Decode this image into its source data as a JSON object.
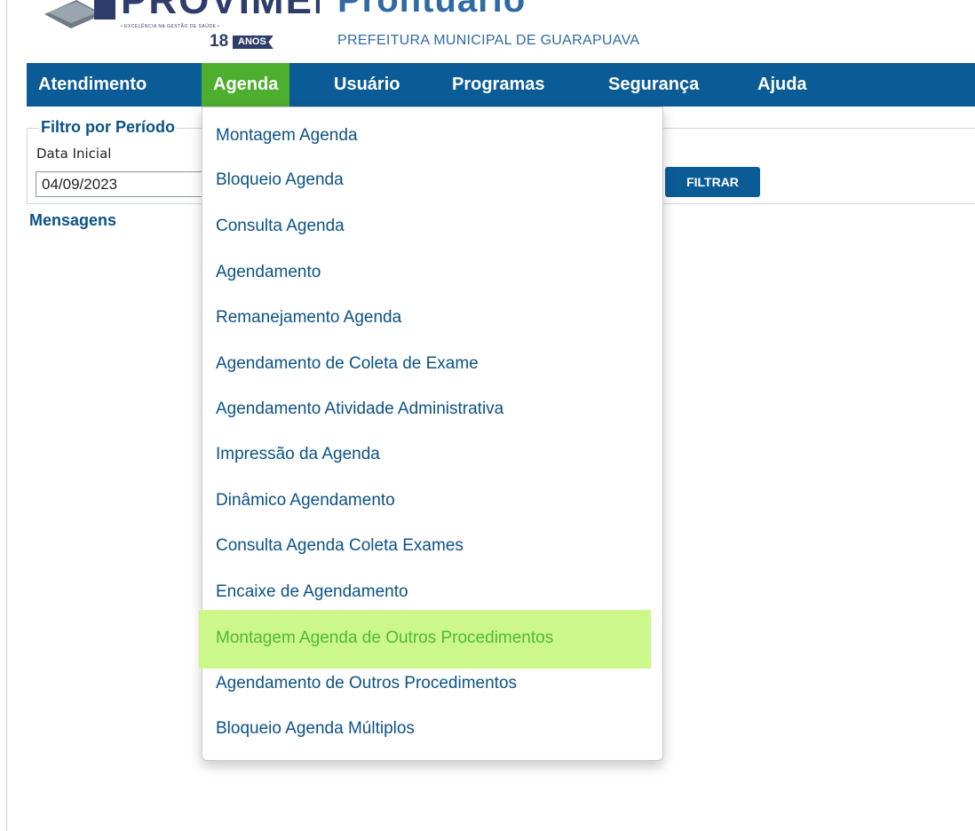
{
  "header": {
    "logo_wordmark": "PROVIMEDIO",
    "logo_tagline": "• EXCELÊNCIA NA GESTÃO DE SAÚDE •",
    "logo_years": "18",
    "logo_years_label": "ANOS",
    "app_title": "Prontuario",
    "subtitle": "PREFEITURA MUNICIPAL DE GUARAPUAVA"
  },
  "nav": {
    "items": [
      {
        "label": "Atendimento"
      },
      {
        "label": "Agenda",
        "active": true
      },
      {
        "label": "Usuário"
      },
      {
        "label": "Programas"
      },
      {
        "label": "Segurança"
      },
      {
        "label": "Ajuda"
      }
    ],
    "colors": {
      "bar": "#0b5c96",
      "active": "#4caf2e"
    }
  },
  "filter": {
    "legend": "Filtro por Período",
    "date_label": "Data Inicial",
    "date_value": "04/09/2023",
    "button_label": "FILTRAR"
  },
  "messages": {
    "title": "Mensagens"
  },
  "agenda_menu": {
    "items": [
      {
        "label": "Montagem Agenda"
      },
      {
        "label": "Bloqueio Agenda"
      },
      {
        "label": "Consulta Agenda"
      },
      {
        "label": "Agendamento"
      },
      {
        "label": "Remanejamento Agenda"
      },
      {
        "label": "Agendamento de Coleta de Exame"
      },
      {
        "label": "Agendamento Atividade Administrativa"
      },
      {
        "label": "Impressão da Agenda"
      },
      {
        "label": "Dinâmico Agendamento"
      },
      {
        "label": "Consulta Agenda Coleta Exames"
      },
      {
        "label": "Encaixe de Agendamento"
      },
      {
        "label": "Montagem Agenda de Outros Procedimentos",
        "highlighted": true
      },
      {
        "label": "Agendamento de Outros Procedimentos"
      },
      {
        "label": "Bloqueio Agenda Múltiplos"
      }
    ],
    "highlight_color": "#ccf78a"
  }
}
